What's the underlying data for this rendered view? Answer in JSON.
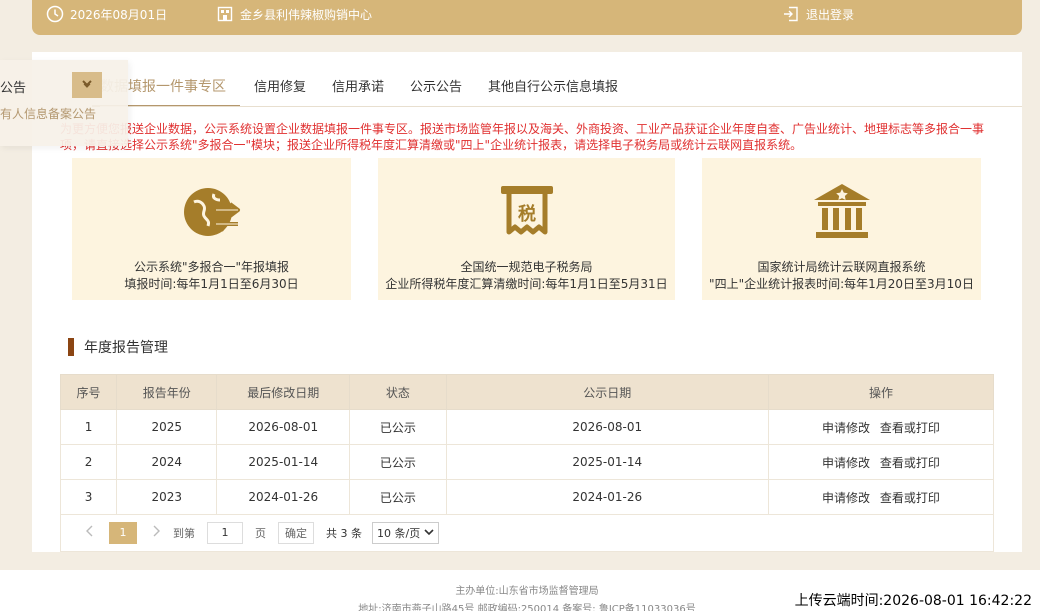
{
  "topbar": {
    "date": "2026年08月01日",
    "org": "金乡县利伟辣椒购销中心",
    "logout": "退出登录"
  },
  "side_popup": {
    "item1": "公告",
    "item2": "有人信息备案公告"
  },
  "tabs": [
    {
      "label": "数据填报一件事专区"
    },
    {
      "label": "信用修复"
    },
    {
      "label": "信用承诺"
    },
    {
      "label": "公示公告"
    },
    {
      "label": "其他自行公示信息填报"
    }
  ],
  "notice": "为更方便您报送企业数据，公示系统设置企业数据填报一件事专区。报送市场监管年报以及海关、外商投资、工业产品获证企业年度自查、广告业统计、地理标志等多报合一事项，请直接选择公示系统\"多报合一\"模块；报送企业所得税年度汇算清缴或\"四上\"企业统计报表，请选择电子税务局或统计云联网直报系统。",
  "cards": [
    {
      "line1": "公示系统\"多报合一\"年报填报",
      "line2": "填报时间:每年1月1日至6月30日",
      "icon": "globe-arrows-icon"
    },
    {
      "line1": "全国统一规范电子税务局",
      "line2": "企业所得税年度汇算清缴时间:每年1月1日至5月31日",
      "icon": "tax-receipt-icon",
      "glyph": "税"
    },
    {
      "line1": "国家统计局统计云联网直报系统",
      "line2": "\"四上\"企业统计报表时间:每年1月20日至3月10日",
      "icon": "government-building-icon"
    }
  ],
  "section_title": "年度报告管理",
  "table": {
    "headers": [
      "序号",
      "报告年份",
      "最后修改日期",
      "状态",
      "公示日期",
      "操作"
    ],
    "rows": [
      {
        "no": "1",
        "year": "2025",
        "modified": "2026-08-01",
        "status": "已公示",
        "published": "2026-08-01",
        "op1": "申请修改",
        "op2": "查看或打印"
      },
      {
        "no": "2",
        "year": "2024",
        "modified": "2025-01-14",
        "status": "已公示",
        "published": "2025-01-14",
        "op1": "申请修改",
        "op2": "查看或打印"
      },
      {
        "no": "3",
        "year": "2023",
        "modified": "2024-01-26",
        "status": "已公示",
        "published": "2024-01-26",
        "op1": "申请修改",
        "op2": "查看或打印"
      }
    ]
  },
  "pager": {
    "current": "1",
    "goto_label": "到第",
    "goto_value": "1",
    "page_label": "页",
    "confirm": "确定",
    "total": "共 3 条",
    "page_size": "10 条/页"
  },
  "footer": {
    "line1": "主办单位:山东省市场监督管理局",
    "line2": "地址:济南市燕子山路45号    邮政编码:250014    备案号: 鲁ICP备11033036号"
  },
  "upload_time": "上传云端时间:2026-08-01 16:42:22",
  "colors": {
    "gold": "#d6b679",
    "card_bg": "#fdf4df",
    "icon": "#a57d2a",
    "notice": "#e03030",
    "section_bar": "#8b4513"
  }
}
